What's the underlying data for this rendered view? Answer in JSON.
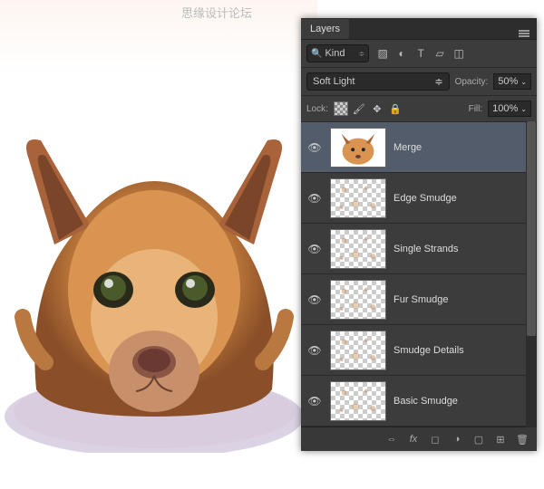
{
  "watermark": "思缘设计论坛",
  "panel": {
    "tab": "Layers",
    "filter": {
      "kind": "Kind"
    },
    "blend": {
      "mode": "Soft Light",
      "opacity_label": "Opacity:",
      "opacity": "50%"
    },
    "lock": {
      "label": "Lock:",
      "fill_label": "Fill:",
      "fill": "100%"
    },
    "layers": [
      {
        "name": "Merge",
        "selected": true,
        "transparent": false
      },
      {
        "name": "Edge Smudge",
        "selected": false,
        "transparent": true
      },
      {
        "name": "Single Strands",
        "selected": false,
        "transparent": true
      },
      {
        "name": "Fur Smudge",
        "selected": false,
        "transparent": true
      },
      {
        "name": "Smudge Details",
        "selected": false,
        "transparent": true
      },
      {
        "name": "Basic Smudge",
        "selected": false,
        "transparent": true
      }
    ]
  }
}
